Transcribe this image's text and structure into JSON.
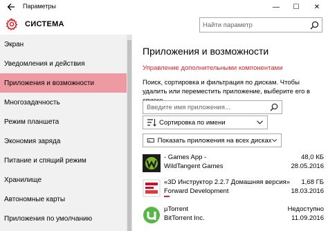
{
  "window": {
    "title": "Параметры",
    "minimize": "—",
    "maximize": "☐",
    "close": "✕"
  },
  "header": {
    "section_title": "СИСТЕМА",
    "search_placeholder": "Найти параметр"
  },
  "sidebar": {
    "items": [
      {
        "label": "Экран"
      },
      {
        "label": "Уведомления и действия"
      },
      {
        "label": "Приложения и возможности",
        "selected": true
      },
      {
        "label": "Многозадачность"
      },
      {
        "label": "Режим планшета"
      },
      {
        "label": "Экономия заряда"
      },
      {
        "label": "Питание и спящий режим"
      },
      {
        "label": "Хранилище"
      },
      {
        "label": "Автономные карты"
      },
      {
        "label": "Приложения по умолчанию"
      }
    ]
  },
  "main": {
    "title": "Приложения и возможности",
    "manage_link": "Управление дополнительными компонентами",
    "description": "Поиск, сортировка и фильтрация по дискам. Чтобы удалить или переместить приложение, выберите его в списке.",
    "app_search_placeholder": "Введите имя приложения...",
    "sort_label": "Сортировка по имени",
    "filter_label": "Показать приложения на всех дисках",
    "apps": [
      {
        "name": "- Games App -",
        "publisher": "WildTangent Games",
        "size": "48,0 КБ",
        "date": "28.05.2016",
        "icon": "wildtangent-icon"
      },
      {
        "name": "«3D Инструктор 2.2.7 Домашняя версия»",
        "publisher": "Forward Development",
        "size": "1,68 ГБ",
        "date": "18.03.2016",
        "icon": "3d-instructor-icon"
      },
      {
        "name": "µTorrent",
        "publisher": "BitTorrent Inc.",
        "size": "Недоступно",
        "date": "11.09.2016",
        "icon": "utorrent-icon"
      }
    ]
  },
  "colors": {
    "accent": "#d4232b",
    "selected_bg": "#ee9aa2",
    "sidebar_bg": "#f1f1f1"
  }
}
